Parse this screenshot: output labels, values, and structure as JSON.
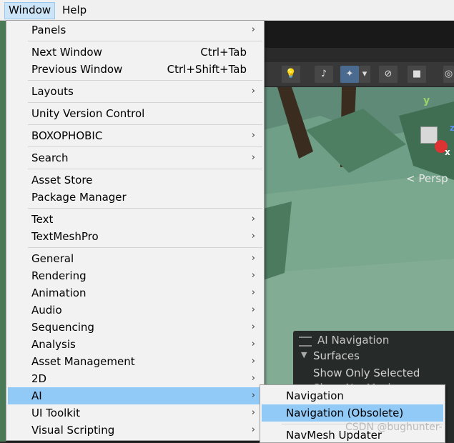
{
  "menubar": {
    "window": "Window",
    "help": "Help"
  },
  "window_menu": {
    "groups": [
      [
        {
          "label": "Panels",
          "submenu": true
        }
      ],
      [
        {
          "label": "Next Window",
          "shortcut": "Ctrl+Tab"
        },
        {
          "label": "Previous Window",
          "shortcut": "Ctrl+Shift+Tab"
        }
      ],
      [
        {
          "label": "Layouts",
          "submenu": true
        }
      ],
      [
        {
          "label": "Unity Version Control"
        }
      ],
      [
        {
          "label": "BOXOPHOBIC",
          "submenu": true
        }
      ],
      [
        {
          "label": "Search",
          "submenu": true
        }
      ],
      [
        {
          "label": "Asset Store"
        },
        {
          "label": "Package Manager"
        }
      ],
      [
        {
          "label": "Text",
          "submenu": true
        },
        {
          "label": "TextMeshPro",
          "submenu": true
        }
      ],
      [
        {
          "label": "General",
          "submenu": true
        },
        {
          "label": "Rendering",
          "submenu": true
        },
        {
          "label": "Animation",
          "submenu": true
        },
        {
          "label": "Audio",
          "submenu": true
        },
        {
          "label": "Sequencing",
          "submenu": true
        },
        {
          "label": "Analysis",
          "submenu": true
        },
        {
          "label": "Asset Management",
          "submenu": true
        },
        {
          "label": "2D",
          "submenu": true
        },
        {
          "label": "AI",
          "submenu": true,
          "highlighted": true
        },
        {
          "label": "UI Toolkit",
          "submenu": true
        },
        {
          "label": "Visual Scripting",
          "submenu": true
        }
      ]
    ]
  },
  "ai_submenu": {
    "items": [
      {
        "label": "Navigation"
      },
      {
        "label": "Navigation (Obsolete)",
        "highlighted": true
      },
      {
        "label": "NavMesh Updater"
      }
    ]
  },
  "scene": {
    "axis_y": "y",
    "axis_z": "z",
    "axis_x": "x",
    "persp_label": "Persp",
    "overlay": {
      "title": "AI Navigation",
      "surfaces": "Surfaces",
      "show_only_selected": "Show Only Selected",
      "show_navmesh": "Show NavMesh"
    }
  },
  "watermark": "CSDN @bughunter-",
  "icons": {
    "submenu_arrow": "›",
    "play": "▶",
    "pause": "❚❚",
    "step": "▶|",
    "collapse": "▼"
  },
  "colors": {
    "highlight": "#91c9f7",
    "menu_bg": "#f2f2f2",
    "menubar_active": "#cce4f7"
  }
}
